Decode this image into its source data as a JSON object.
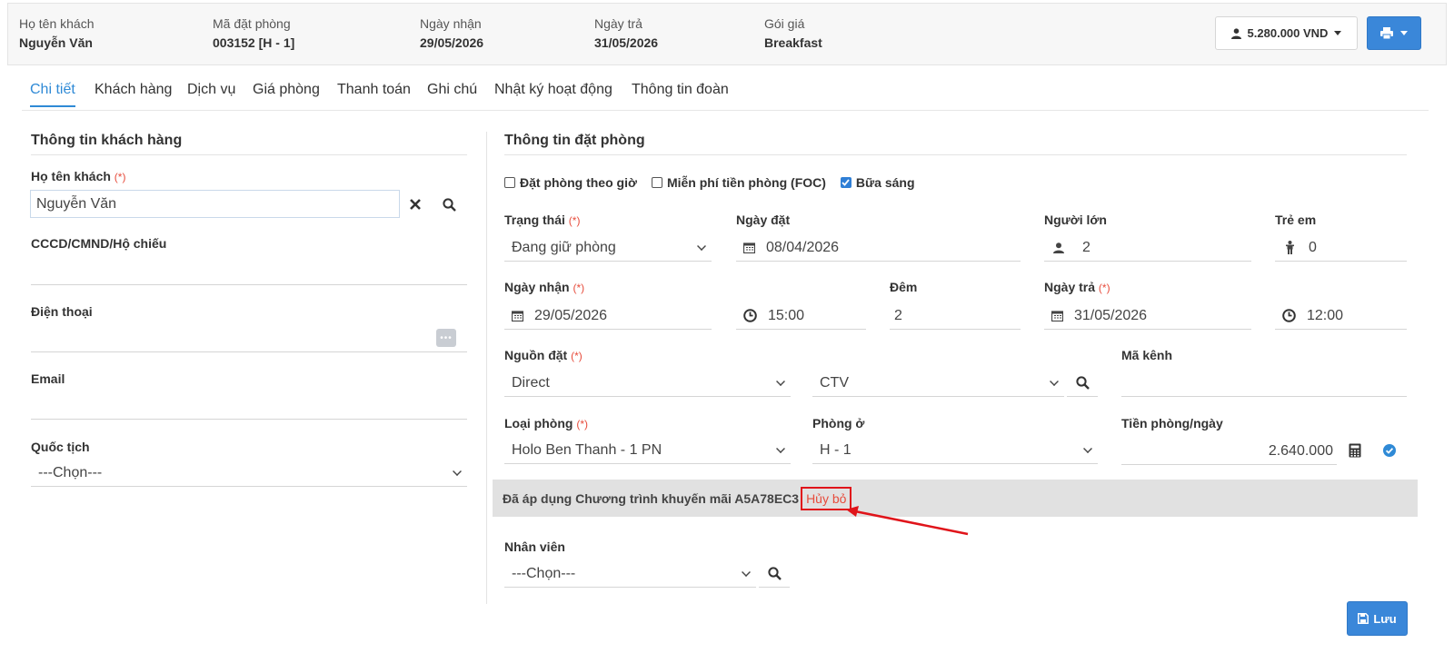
{
  "summary": {
    "guest_label": "Họ tên khách",
    "guest_value": "Nguyễn Văn",
    "booking_label": "Mã đặt phòng",
    "booking_value": "003152 [H - 1]",
    "checkin_label": "Ngày nhận",
    "checkin_value": "29/05/2026",
    "checkout_label": "Ngày trả",
    "checkout_value": "31/05/2026",
    "rate_label": "Gói giá",
    "rate_value": "Breakfast",
    "total": "5.280.000 VND"
  },
  "tabs": [
    "Chi tiết",
    "Khách hàng",
    "Dịch vụ",
    "Giá phòng",
    "Thanh toán",
    "Ghi chú",
    "Nhật ký hoạt động",
    "Thông tin đoàn"
  ],
  "customer": {
    "title": "Thông tin khách hàng",
    "name_label": "Họ tên khách",
    "name_value": "Nguyễn Văn",
    "id_label": "CCCD/CMND/Hộ chiếu",
    "phone_label": "Điện thoại",
    "email_label": "Email",
    "nationality_label": "Quốc tịch",
    "nationality_value": "---Chọn---"
  },
  "booking": {
    "title": "Thông tin đặt phòng",
    "hourly_label": "Đặt phòng theo giờ",
    "foc_label": "Miễn phí tiền phòng (FOC)",
    "breakfast_label": "Bữa sáng",
    "status_label": "Trạng thái",
    "status_value": "Đang giữ phòng",
    "booked_date_label": "Ngày đặt",
    "booked_date_value": "08/04/2026",
    "adults_label": "Người lớn",
    "adults_value": "2",
    "children_label": "Trẻ em",
    "children_value": "0",
    "checkin_label": "Ngày nhận",
    "checkin_date": "29/05/2026",
    "checkin_time": "15:00",
    "nights_label": "Đêm",
    "nights_value": "2",
    "checkout_label": "Ngày trả",
    "checkout_date": "31/05/2026",
    "checkout_time": "12:00",
    "source_label": "Nguồn đặt",
    "source_value": "Direct",
    "source_sub_value": "CTV",
    "channel_label": "Mã kênh",
    "room_type_label": "Loại phòng",
    "room_type_value": "Holo Ben Thanh - 1 PN",
    "room_label": "Phòng ở",
    "room_value": "H - 1",
    "rate_label": "Tiền phòng/ngày",
    "rate_value": "2.640.000",
    "promo_text": "Đã áp dụng Chương trình khuyến mãi A5A78EC3",
    "promo_cancel": "Hủy bỏ",
    "staff_label": "Nhân viên",
    "staff_value": "---Chọn---"
  },
  "required_mark": "(*)",
  "save_label": "Lưu",
  "colors": {
    "primary": "#3a87d9",
    "tab_active": "#2f8ad6",
    "required": "#e74c3c",
    "annotation": "#e0141a"
  }
}
